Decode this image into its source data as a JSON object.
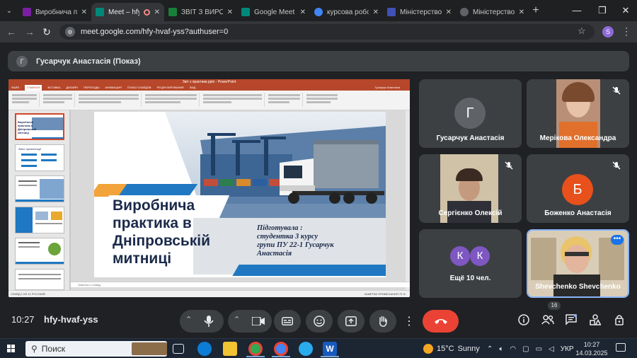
{
  "browser": {
    "tabs": [
      {
        "title": "Виробнича пра",
        "color": "#7b1fa2"
      },
      {
        "title": "Meet – hfy",
        "color": "#00897b",
        "active": true
      },
      {
        "title": "ЗВІТ З ВИРОБ",
        "color": "#188038"
      },
      {
        "title": "Google Meet",
        "color": "#00897b"
      },
      {
        "title": "курсова робо",
        "color": "#4285f4"
      },
      {
        "title": "Міністерство",
        "color": "#3f51b5"
      },
      {
        "title": "Міністерство",
        "color": "#5f6368"
      }
    ],
    "url": "meet.google.com/hfy-hvaf-yss?authuser=0",
    "profile_initial": "S"
  },
  "presentation_bar": {
    "avatar": "Г",
    "label": "Гусарчук Анастасія (Показ)"
  },
  "powerpoint": {
    "window_title": "Звіт з практики.pptx - PowerPoint",
    "ribbon_tabs": [
      "ФАЙЛ",
      "ГЛАВНАЯ",
      "ВСТАВКА",
      "ДИЗАЙН",
      "ПЕРЕХОДЫ",
      "АНИМАЦИЯ",
      "ПОКАЗ СЛАЙДОВ",
      "РЕЦЕНЗИРОВАНИЕ",
      "ВИД"
    ],
    "user": "Гусарчук Анастасія",
    "notes_placeholder": "Заметки к слайду",
    "status": "СЛАЙД 1 ИЗ 11    РУССКИЙ",
    "status_right": "ЗАМЕТКИ    ПРИМЕЧАНИЯ    72 %",
    "slide": {
      "title": "Виробнича практика в Дніпровській митниці",
      "subtitle": "Підготувала : студентка 3 курсу групи ПУ 22-1 Гусарчук Анастасія"
    },
    "thumb_titles": [
      "Виробнича практика в Дніпровській митниці",
      "Зміст презентації"
    ]
  },
  "participants": [
    {
      "name": "Гусарчук Анастасія",
      "initial": "Г",
      "color": "#5f6368",
      "muted": false
    },
    {
      "name": "Мерікова Олександра",
      "muted": true
    },
    {
      "name": "Сергієнко Олексій",
      "muted": true
    },
    {
      "name": "Боженко Анастасія",
      "initial": "Б",
      "color": "#e8501c",
      "muted": true
    },
    {
      "name": "Ещё 10 чел.",
      "initials": [
        "К",
        "К"
      ],
      "color": "#7e57c2"
    },
    {
      "name": "Shevchenko Shevchenko",
      "muted": false
    }
  ],
  "controls": {
    "time": "10:27",
    "meeting_code": "hfy-hvaf-yss",
    "people_count": "16"
  },
  "taskbar": {
    "search_placeholder": "Поиск",
    "weather_temp": "15°C",
    "weather_desc": "Sunny",
    "lang": "УКР",
    "time": "10:27",
    "date": "14.03.2025"
  }
}
